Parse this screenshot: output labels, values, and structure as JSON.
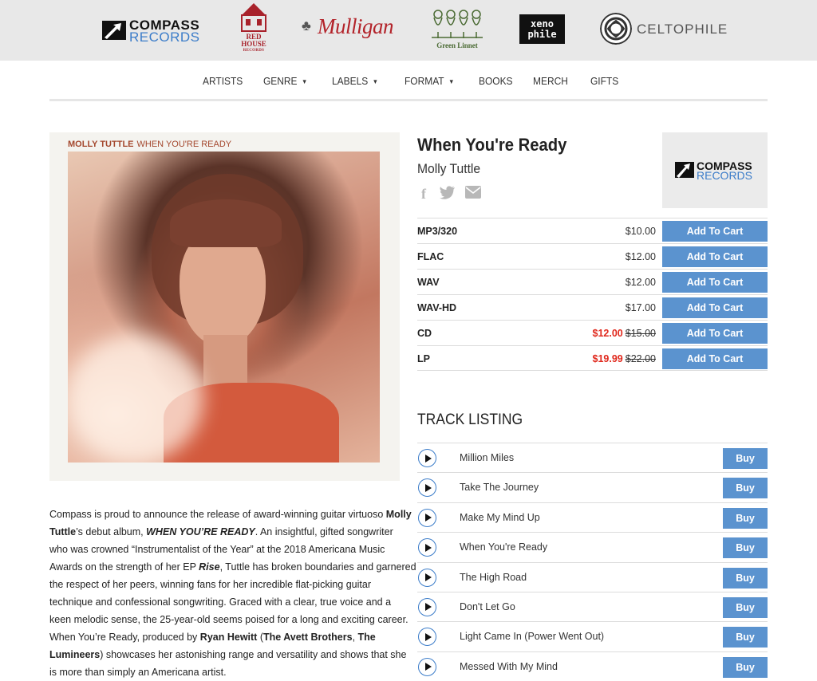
{
  "labels_strip": {
    "compass": {
      "word1": "COMPASS",
      "word2": "RECORDS"
    },
    "redhouse": {
      "line1": "RED",
      "line2": "HOUSE",
      "line3": "RECORDS"
    },
    "mulligan": {
      "name": "Mulligan"
    },
    "greenlinnet": {
      "name": "Green Linnet"
    },
    "xenophile": {
      "line1": "xeno",
      "line2": "phile"
    },
    "celtophile": {
      "name": "CELTOPHILE"
    }
  },
  "nav": {
    "items": [
      {
        "label": "ARTISTS",
        "caret": ""
      },
      {
        "label": "GENRE",
        "caret": "▼"
      },
      {
        "label": "LABELS",
        "caret": "▼"
      },
      {
        "label": "FORMAT",
        "caret": "▼"
      },
      {
        "label": "BOOKS",
        "caret": ""
      },
      {
        "label": "MERCH",
        "caret": ""
      },
      {
        "label": "GIFTS",
        "caret": ""
      }
    ]
  },
  "album_art": {
    "artist": "MOLLY TUTTLE",
    "title": "WHEN YOU'RE READY"
  },
  "product": {
    "title": "When You're Ready",
    "artist": "Molly Tuttle",
    "share_icons": [
      "facebook-icon",
      "twitter-icon",
      "email-icon"
    ],
    "label_logo": {
      "word1": "COMPASS",
      "word2": "RECORDS"
    }
  },
  "formats": [
    {
      "name": "MP3/320",
      "price": "$10.00",
      "sale_price": "",
      "button": "Add To Cart"
    },
    {
      "name": "FLAC",
      "price": "$12.00",
      "sale_price": "",
      "button": "Add To Cart"
    },
    {
      "name": "WAV",
      "price": "$12.00",
      "sale_price": "",
      "button": "Add To Cart"
    },
    {
      "name": "WAV-HD",
      "price": "$17.00",
      "sale_price": "",
      "button": "Add To Cart"
    },
    {
      "name": "CD",
      "price": "$15.00",
      "sale_price": "$12.00",
      "button": "Add To Cart"
    },
    {
      "name": "LP",
      "price": "$22.00",
      "sale_price": "$19.99",
      "button": "Add To Cart"
    }
  ],
  "track_listing": {
    "heading": "TRACK LISTING",
    "buy_label": "Buy",
    "tracks": [
      "Million Miles",
      "Take The Journey",
      "Make My Mind Up",
      "When You're Ready",
      "The High Road",
      "Don't Let Go",
      "Light Came In (Power Went Out)",
      "Messed With My Mind"
    ]
  },
  "description": {
    "l1a": "Compass is proud to announce the release of award-winning guitar virtuoso ",
    "l1b": "Molly",
    "l2a": "Tuttle",
    "l2b": "’s debut album, ",
    "l2c": "WHEN YOU’RE READY",
    "l2d": ". An insightful, gifted songwriter",
    "l3": "who was crowned “Instrumentalist of the Year” at the 2018 Americana Music",
    "l4a": "Awards on the strength of her EP ",
    "l4b": "Rise",
    "l4c": ", Tuttle has broken boundaries and garnered",
    "l5": "the respect of her peers, winning fans for her incredible flat-picking guitar",
    "l6": "technique and confessional songwriting. Graced with a clear, true voice and a",
    "l7": "keen melodic sense, the 25-year-old seems poised for a long and exciting career.",
    "l8a": "When You’re Ready, produced by ",
    "l8b": "Ryan Hewitt",
    "l8c": " (",
    "l8d": "The Avett Brothers",
    "l8e": ", ",
    "l8f": "The",
    "l9a": "Lumineers",
    "l9b": ") showcases her astonishing range and versatility and shows that she",
    "l10": "is more than simply an Americana artist."
  }
}
